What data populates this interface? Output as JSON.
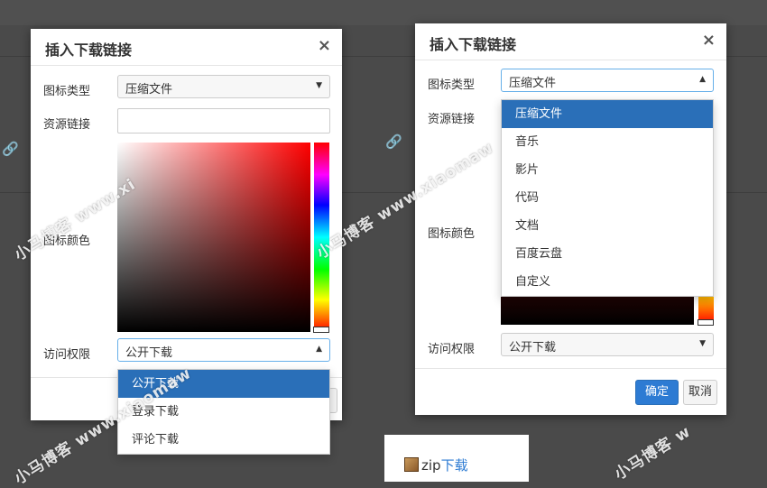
{
  "left_dialog": {
    "title": "插入下载链接",
    "close": "×",
    "labels": {
      "icon_type": "图标类型",
      "resource_link": "资源链接",
      "icon_color": "图标颜色",
      "access": "访问权限"
    },
    "icon_type_value": "压缩文件",
    "access_value": "公开下载",
    "access_options": [
      "公开下载",
      "登录下载",
      "评论下载"
    ],
    "access_selected_index": 0
  },
  "right_dialog": {
    "title": "插入下载链接",
    "close": "×",
    "labels": {
      "icon_type": "图标类型",
      "resource_link": "资源链接",
      "icon_color": "图标颜色",
      "access": "访问权限"
    },
    "icon_type_value": "压缩文件",
    "icon_type_options": [
      "压缩文件",
      "音乐",
      "影片",
      "代码",
      "文档",
      "百度云盘",
      "自定义"
    ],
    "icon_type_selected_index": 0,
    "access_value": "公开下载",
    "ok_label": "确定",
    "cancel_label": "取消"
  },
  "preview": {
    "prefix": "zip",
    "link_text": "下载",
    "icon": "package-icon"
  },
  "watermarks": [
    "小马博客 www.xi",
    "小马博客 www.xiaomaw",
    "小马博客 www.xiaomaw",
    "小马博客 w"
  ],
  "colors": {
    "primary": "#2d7bd3",
    "selected": "#2a6fb8",
    "backdrop": "#4a4a4a"
  }
}
